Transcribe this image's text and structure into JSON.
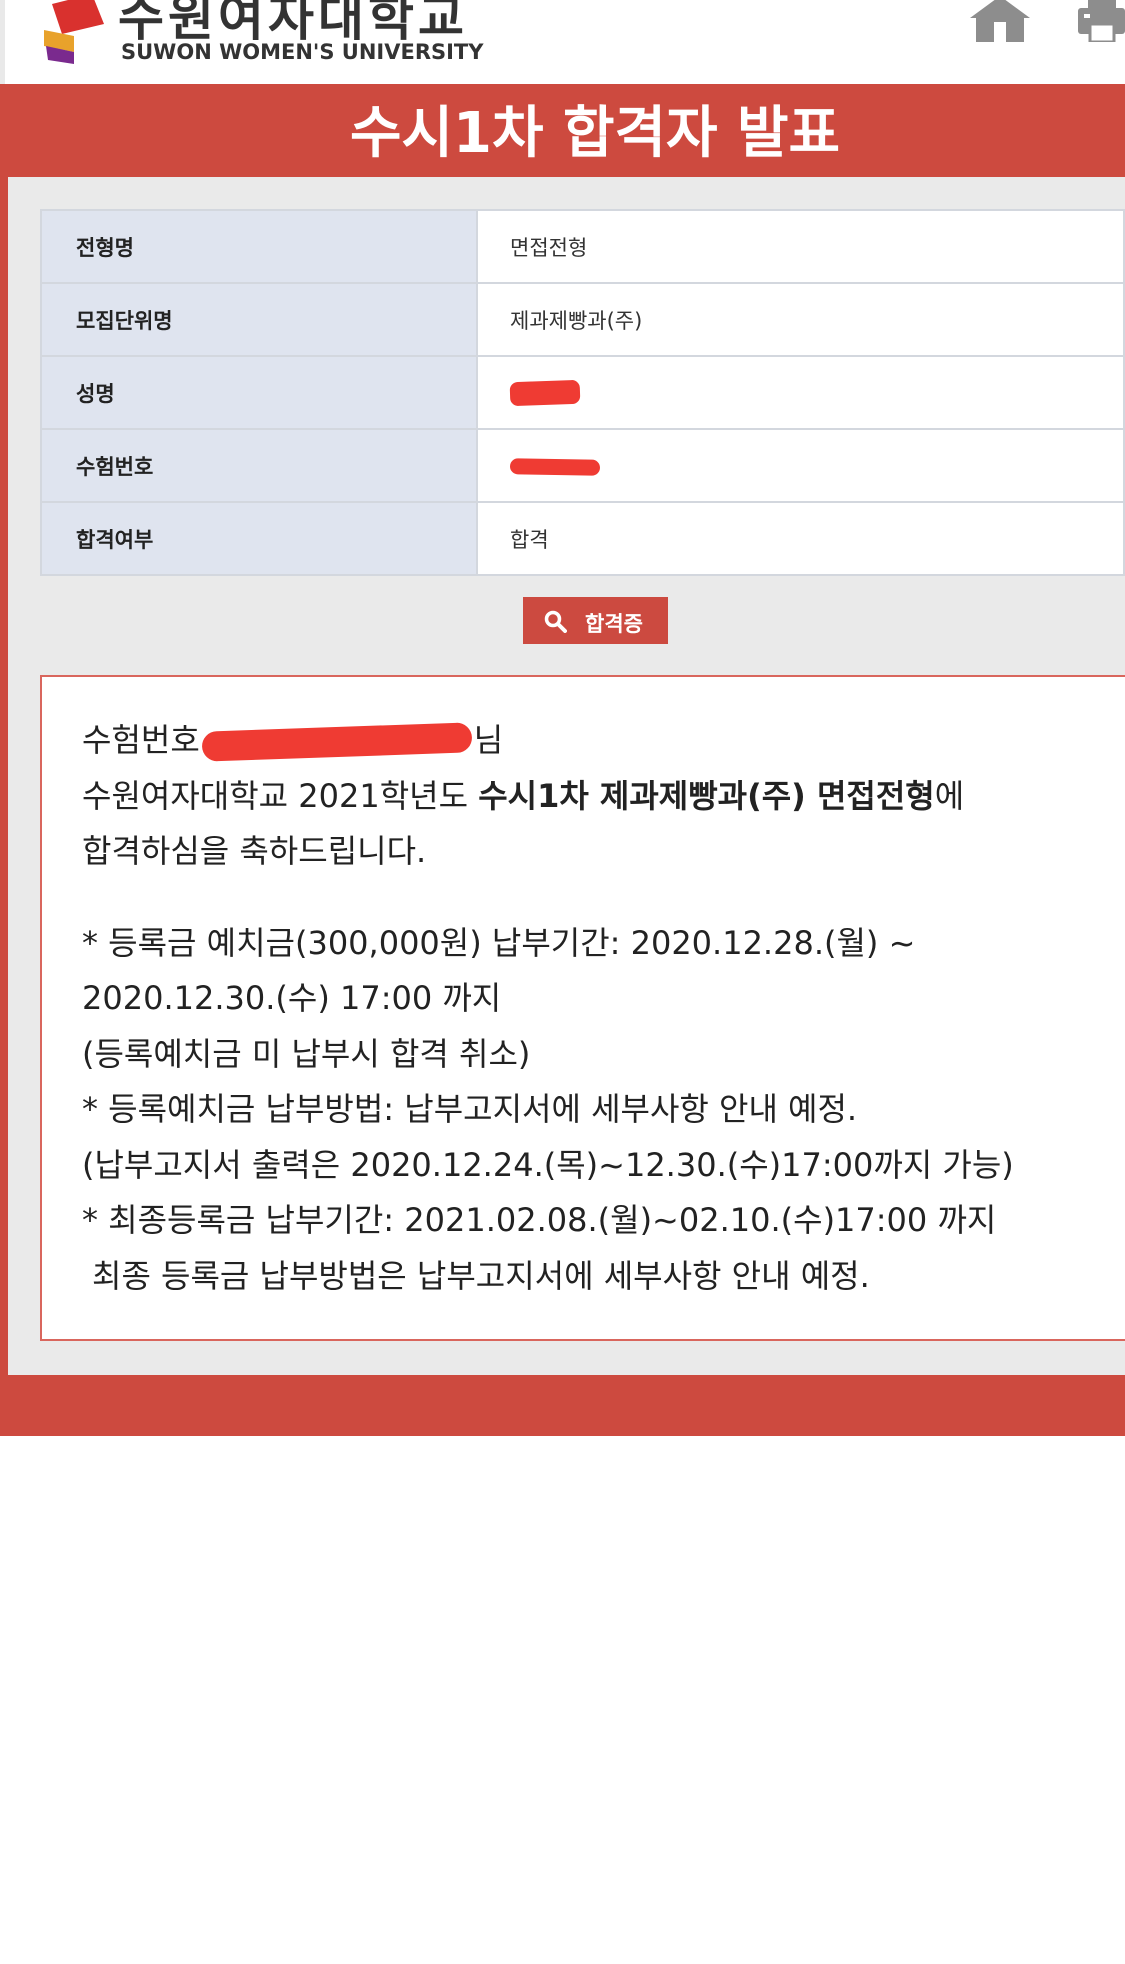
{
  "header": {
    "logo_korean": "수원여자대학교",
    "logo_english": "SUWON WOMEN'S UNIVERSITY",
    "home_icon": "home-icon",
    "print_icon": "print-icon"
  },
  "page_title": "수시1차 합격자 발표",
  "info_table": [
    {
      "label": "전형명",
      "value": "면접전형"
    },
    {
      "label": "모집단위명",
      "value": "제과제빵과(주)"
    },
    {
      "label": "성명",
      "value": ""
    },
    {
      "label": "수험번호",
      "value": ""
    },
    {
      "label": "합격여부",
      "value": "합격"
    }
  ],
  "certificate_button": {
    "label": "합격증",
    "icon": "search-icon"
  },
  "notice": {
    "line1_prefix": "수험번호",
    "line1_suffix": "님",
    "line2_prefix": "수원여자대학교 2021학년도 ",
    "line2_bold": "수시1차 제과제빵과(주)  면접전형",
    "line2_suffix": "에",
    "line3": "합격하심을 축하드립니다.",
    "details": [
      "* 등록금 예치금(300,000원) 납부기간: 2020.12.28.(월) ~",
      "2020.12.30.(수) 17:00 까지",
      "(등록예치금 미 납부시 합격 취소)",
      "* 등록예치금 납부방법: 납부고지서에 세부사항 안내 예정.",
      "(납부고지서 출력은 2020.12.24.(목)~12.30.(수)17:00까지 가능)",
      "* 최종등록금 납부기간: 2021.02.08.(월)~02.10.(수)17:00 까지",
      "최종 등록금 납부방법은 납부고지서에 세부사항 안내 예정."
    ]
  },
  "colors": {
    "brand_red": "#cd4a3f",
    "table_header_bg": "#dfe4ef",
    "redaction": "#ef3b33"
  }
}
